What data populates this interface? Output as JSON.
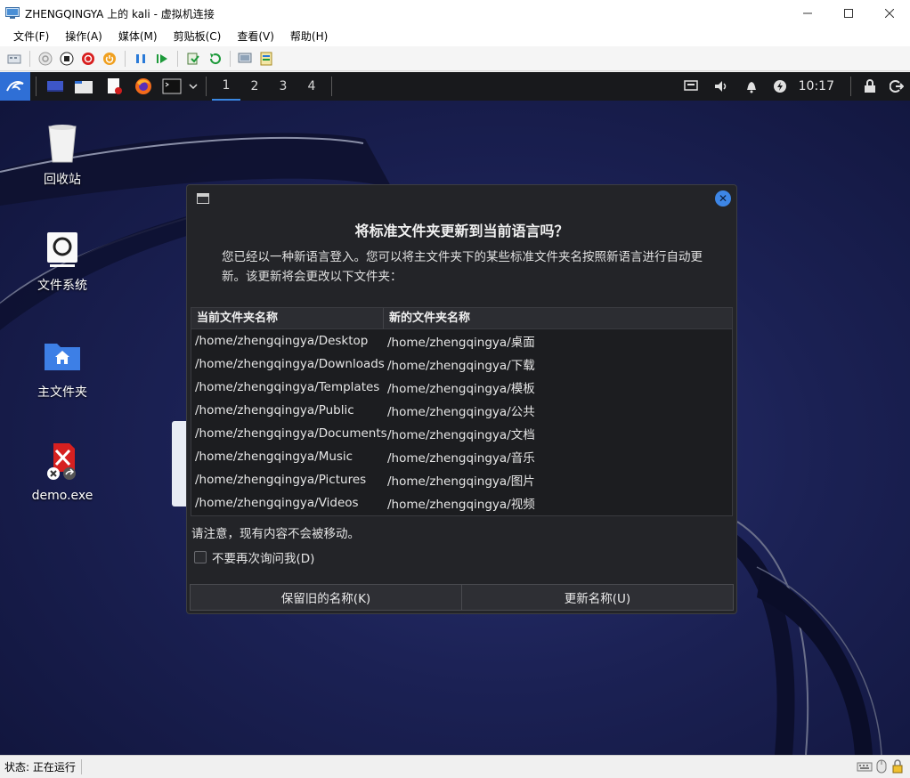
{
  "window": {
    "title": "ZHENGQINGYA 上的 kali - 虚拟机连接"
  },
  "menubar": {
    "items": [
      "文件(F)",
      "操作(A)",
      "媒体(M)",
      "剪贴板(C)",
      "查看(V)",
      "帮助(H)"
    ]
  },
  "statusbar": {
    "text": "状态: 正在运行"
  },
  "guest_panel": {
    "workspaces": [
      "1",
      "2",
      "3",
      "4"
    ],
    "active_workspace": "1",
    "clock": "10:17"
  },
  "desktop": {
    "icons": [
      {
        "label": "回收站",
        "icon": "trash-icon"
      },
      {
        "label": "文件系统",
        "icon": "drive-icon"
      },
      {
        "label": "主文件夹",
        "icon": "home-folder-icon"
      },
      {
        "label": "demo.exe",
        "icon": "exe-file-icon"
      }
    ]
  },
  "dialog": {
    "heading": "将标准文件夹更新到当前语言吗？",
    "description": "您已经以一种新语言登入。您可以将主文件夹下的某些标准文件夹名按照新语言进行自动更新。该更新将会更改以下文件夹：",
    "columns": [
      "当前文件夹名称",
      "新的文件夹名称"
    ],
    "rows": [
      [
        "/home/zhengqingya/Desktop",
        "/home/zhengqingya/桌面"
      ],
      [
        "/home/zhengqingya/Downloads",
        "/home/zhengqingya/下载"
      ],
      [
        "/home/zhengqingya/Templates",
        "/home/zhengqingya/模板"
      ],
      [
        "/home/zhengqingya/Public",
        "/home/zhengqingya/公共"
      ],
      [
        "/home/zhengqingya/Documents",
        "/home/zhengqingya/文档"
      ],
      [
        "/home/zhengqingya/Music",
        "/home/zhengqingya/音乐"
      ],
      [
        "/home/zhengqingya/Pictures",
        "/home/zhengqingya/图片"
      ],
      [
        "/home/zhengqingya/Videos",
        "/home/zhengqingya/视频"
      ]
    ],
    "note": "请注意，现有内容不会被移动。",
    "checkbox_label": "不要再次询问我(D)",
    "checkbox_checked": false,
    "button_keep": "保留旧的名称(K)",
    "button_update": "更新名称(U)"
  },
  "colors": {
    "panel_bg": "#18191c",
    "dialog_bg": "#232428",
    "accent": "#3d86e6",
    "desktop_bg": "#1b2154"
  }
}
